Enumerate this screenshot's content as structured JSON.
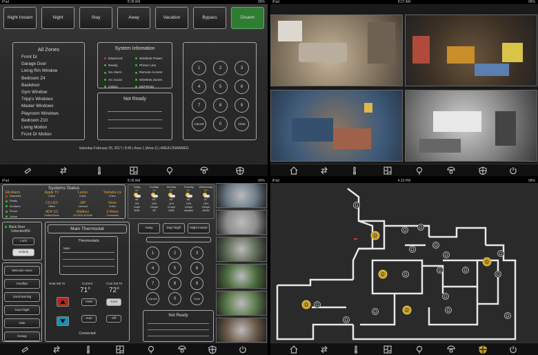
{
  "status_bar": {
    "p1": {
      "carrier": "iPad",
      "time": "8:28 AM",
      "battery": "99%"
    },
    "p2": {
      "carrier": "iPad",
      "time": "8:27 AM",
      "battery": "99%"
    },
    "p3": {
      "carrier": "iPad",
      "time": "8:28 AM",
      "battery": "99%"
    },
    "p4": {
      "carrier": "iPad",
      "time": "4:10 PM",
      "battery": "99%"
    }
  },
  "security": {
    "modes": [
      "Night Instant",
      "Night",
      "Stay",
      "Away",
      "Vacation",
      "Bypass",
      "Disarm"
    ],
    "zones_title": "All Zones",
    "zones": [
      "Front Dr",
      "Garage Door",
      "Living Rm Window",
      "Bedroom Z4",
      "Backdoor",
      "Gym Window",
      "Tripp's Windows",
      "Master Windows",
      "Playroom Windows",
      "Bedroom Z10",
      "Living Motion",
      "Front Dr Motion"
    ],
    "info_title": "System Infomation",
    "info_left": [
      {
        "label": "Disarmed",
        "color": "#dd3333"
      },
      {
        "label": "Ready",
        "color": "#22cc22"
      },
      {
        "label": "No Alarm",
        "color": "#22cc22"
      },
      {
        "label": "AC Good",
        "color": "#22cc22"
      },
      {
        "label": "Online",
        "color": "#22cc22"
      }
    ],
    "info_right": [
      {
        "label": "Wireless Power",
        "color": "#22cc22"
      },
      {
        "label": "Phone Line",
        "color": "#22cc22"
      },
      {
        "label": "Remote Access",
        "color": "#22cc22"
      },
      {
        "label": "Wireless Zones",
        "color": "#22cc22"
      },
      {
        "label": "EEPROM",
        "color": "#22cc22"
      }
    ],
    "not_ready": "Not Ready",
    "keypad": [
      "1",
      "2",
      "3",
      "4",
      "5",
      "6",
      "7",
      "8",
      "9",
      "Cancel",
      "0",
      "Clear"
    ],
    "footer": "Saturday February 25, 2017  |  8:45  |  Area 1 (Area 1)  |  AREA DISARMED"
  },
  "status_panel": {
    "title": "Systems Status",
    "items": [
      {
        "name": "Elk Alarm",
        "status": ""
      },
      {
        "name": "Apple TV",
        "status": "Online"
      },
      {
        "name": "Lutron",
        "status": "Online"
      },
      {
        "name": "Yamaha Liv",
        "status": "Online"
      },
      {
        "name": "CS LED",
        "status": "Offline"
      },
      {
        "name": "JAP",
        "status": "Licensed"
      },
      {
        "name": "Nuvo",
        "status": "Online"
      },
      {
        "name": "AD4 1/2",
        "status": "Online/Online"
      },
      {
        "name": "Wattbox",
        "status": "123.0V/0.4A/32W"
      },
      {
        "name": "Z-Wave",
        "status": "Connected"
      }
    ],
    "elk_list": [
      {
        "label": "Disarmed",
        "color": "#dd3333"
      },
      {
        "label": "Ready",
        "color": "#22cc22"
      },
      {
        "label": "No Alarm",
        "color": "#22cc22"
      },
      {
        "label": "Phone",
        "color": "#22cc22"
      },
      {
        "label": "Online",
        "color": "#22cc22"
      }
    ]
  },
  "weather": [
    {
      "day": "Today",
      "hi": "58°",
      "lo": "48°",
      "pct": "0%",
      "wind": "1mph",
      "dir": "NNE"
    },
    {
      "day": "Sunday",
      "hi": "74°",
      "lo": "65°",
      "pct": "16%",
      "wind": "16mph",
      "dir": "SE"
    },
    {
      "day": "Monday",
      "hi": "82°",
      "lo": "66°",
      "pct": "11%",
      "wind": "11mph",
      "dir": "SSW"
    },
    {
      "day": "Tuesday",
      "hi": "81°",
      "lo": "68°",
      "pct": "14%",
      "wind": "14mph",
      "dir": "Variable"
    },
    {
      "day": "Wednesday",
      "hi": "80°",
      "lo": "51°",
      "pct": "15%",
      "wind": "15mph",
      "dir": "WNW"
    }
  ],
  "door": {
    "title": "Back Door",
    "state": "Unlocked/50",
    "lock": "Lock",
    "unlock": "Unlock"
  },
  "scenes": [
    "Welcome Home",
    "Goodbye",
    "Good Morning",
    "Good Night",
    "Gate",
    "Garage"
  ],
  "thermostat": {
    "title": "Main Thermostat",
    "list_title": "Thermostats",
    "list_item": "Main",
    "heat_set_label": "Heat Set To",
    "current_label": "Current",
    "cool_set_label": "Cool Set To",
    "current": "71°",
    "cool_set": "72°",
    "heat_btn": "Heat",
    "cool_btn": "Cool",
    "auto_btn": "Auto",
    "off_btn": "Off",
    "status": "Connected"
  },
  "mini_keypad": {
    "modes": [
      "Away",
      "Day/ Night",
      "Night Instant"
    ],
    "keys": [
      "1",
      "2",
      "3",
      "4",
      "5",
      "6",
      "7",
      "8",
      "9",
      "Cancel",
      "0",
      "Clear"
    ],
    "not_ready": "Not Ready"
  },
  "colors": {
    "accent_green": "#2e7d32",
    "gold": "#c9a227",
    "red": "#d33"
  }
}
